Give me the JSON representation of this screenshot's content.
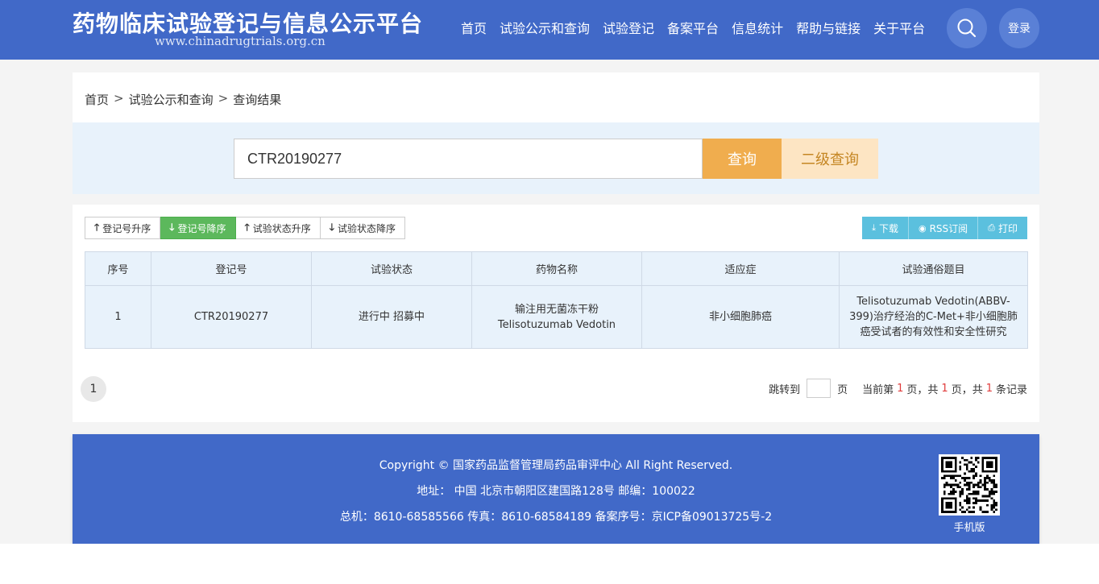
{
  "header": {
    "title": "药物临床试验登记与信息公示平台",
    "subtitle": "www.chinadrugtrials.org.cn",
    "nav": [
      "首页",
      "试验公示和查询",
      "试验登记",
      "备案平台",
      "信息统计",
      "帮助与链接",
      "关于平台"
    ],
    "login_label": "登录",
    "search_icon": "search-icon"
  },
  "breadcrumb": [
    "首页",
    "试验公示和查询",
    "查询结果"
  ],
  "breadcrumb_sep": ">",
  "search": {
    "value": "CTR20190277",
    "query_label": "查询",
    "advanced_label": "二级查询"
  },
  "sort_buttons": [
    "登记号升序",
    "登记号降序",
    "试验状态升序",
    "试验状态降序"
  ],
  "tools": [
    "下载",
    "RSS订阅",
    "打印"
  ],
  "table": {
    "headers": [
      "序号",
      "登记号",
      "试验状态",
      "药物名称",
      "适应症",
      "试验通俗题目"
    ],
    "rows": [
      {
        "index": "1",
        "reg_no": "CTR20190277",
        "status": "进行中 招募中",
        "drug_line1": "输注用无菌冻干粉",
        "drug_line2": "Telisotuzumab Vedotin",
        "indication": "非小细胞肺癌",
        "title": "Telisotuzumab Vedotin(ABBV-399)治疗经治的C-Met+非小细胞肺癌受试者的有效性和安全性研究"
      }
    ]
  },
  "pager": {
    "page_button": "1",
    "jump_label": "跳转到",
    "page_unit": "页",
    "current_prefix": "当前第",
    "current_page": "1",
    "total_prefix": "页，共",
    "total_pages": "1",
    "records_prefix": "页，共",
    "total_records": "1",
    "records_suffix": "条记录"
  },
  "footer": {
    "copyright": "Copyright © 国家药品监督管理局药品审评中心 All Right Reserved.",
    "address": "地址：  中国 北京市朝阳区建国路128号 邮编：100022",
    "contact": "总机：8610-68585566 传真：8610-68584189 备案序号：京ICP备09013725号-2",
    "mobile_label": "手机版"
  },
  "colors": {
    "header_bg": "#4169c8",
    "query_btn": "#f0ad4e",
    "active_sort": "#5cb85c",
    "tool_btn": "#5bc0de",
    "highlight": "#e03c3c"
  }
}
